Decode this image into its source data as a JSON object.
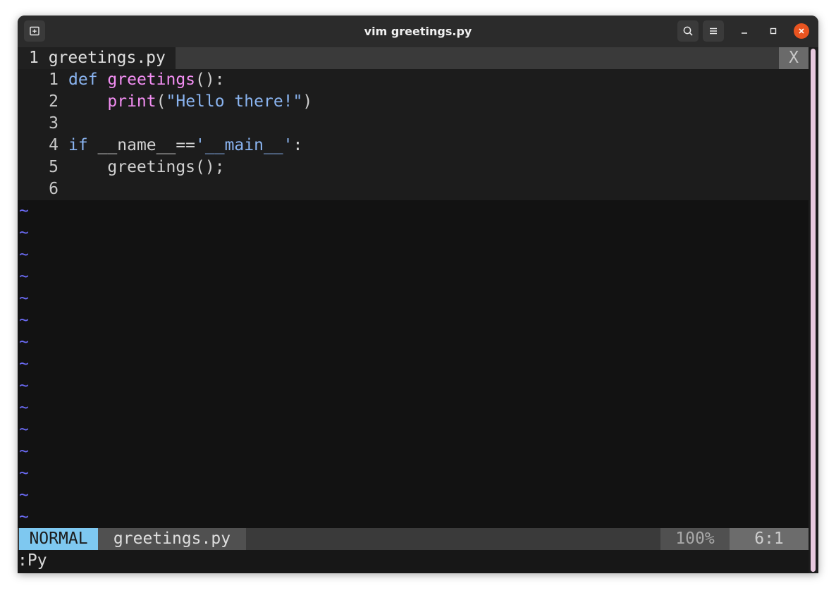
{
  "window": {
    "title": "vim greetings.py"
  },
  "tabline": {
    "active_tab": "1 greetings.py",
    "close_label": "X"
  },
  "code_lines": [
    {
      "num": "1"
    },
    {
      "num": "2"
    },
    {
      "num": "3"
    },
    {
      "num": "4"
    },
    {
      "num": "5"
    },
    {
      "num": "6"
    }
  ],
  "code": {
    "l1_def": "def",
    "l1_name": "greetings",
    "l1_rest": "():",
    "l2_print": "print",
    "l2_open": "(",
    "l2_str": "\"Hello there!\"",
    "l2_close": ")",
    "l4_if": "if",
    "l4_mid": " __name__==",
    "l4_str": "'__main__'",
    "l4_end": ":",
    "l5_text": "greetings();"
  },
  "tilde": "~",
  "statusline": {
    "mode": "NORMAL",
    "filename": "greetings.py",
    "percent": "100%",
    "position": "6:1"
  },
  "cmdline": {
    "text": ":Py"
  },
  "icons": {
    "new_tab": "new-tab-icon",
    "search": "search-icon",
    "menu": "hamburger-menu-icon",
    "minimize": "minimize-icon",
    "maximize": "maximize-icon",
    "close": "close-icon"
  },
  "colors": {
    "mode_bg": "#7ec8f0",
    "close_button": "#e95420",
    "tilde": "#6b6bf5",
    "function": "#f28ef2",
    "keyword": "#8ab4f0"
  }
}
